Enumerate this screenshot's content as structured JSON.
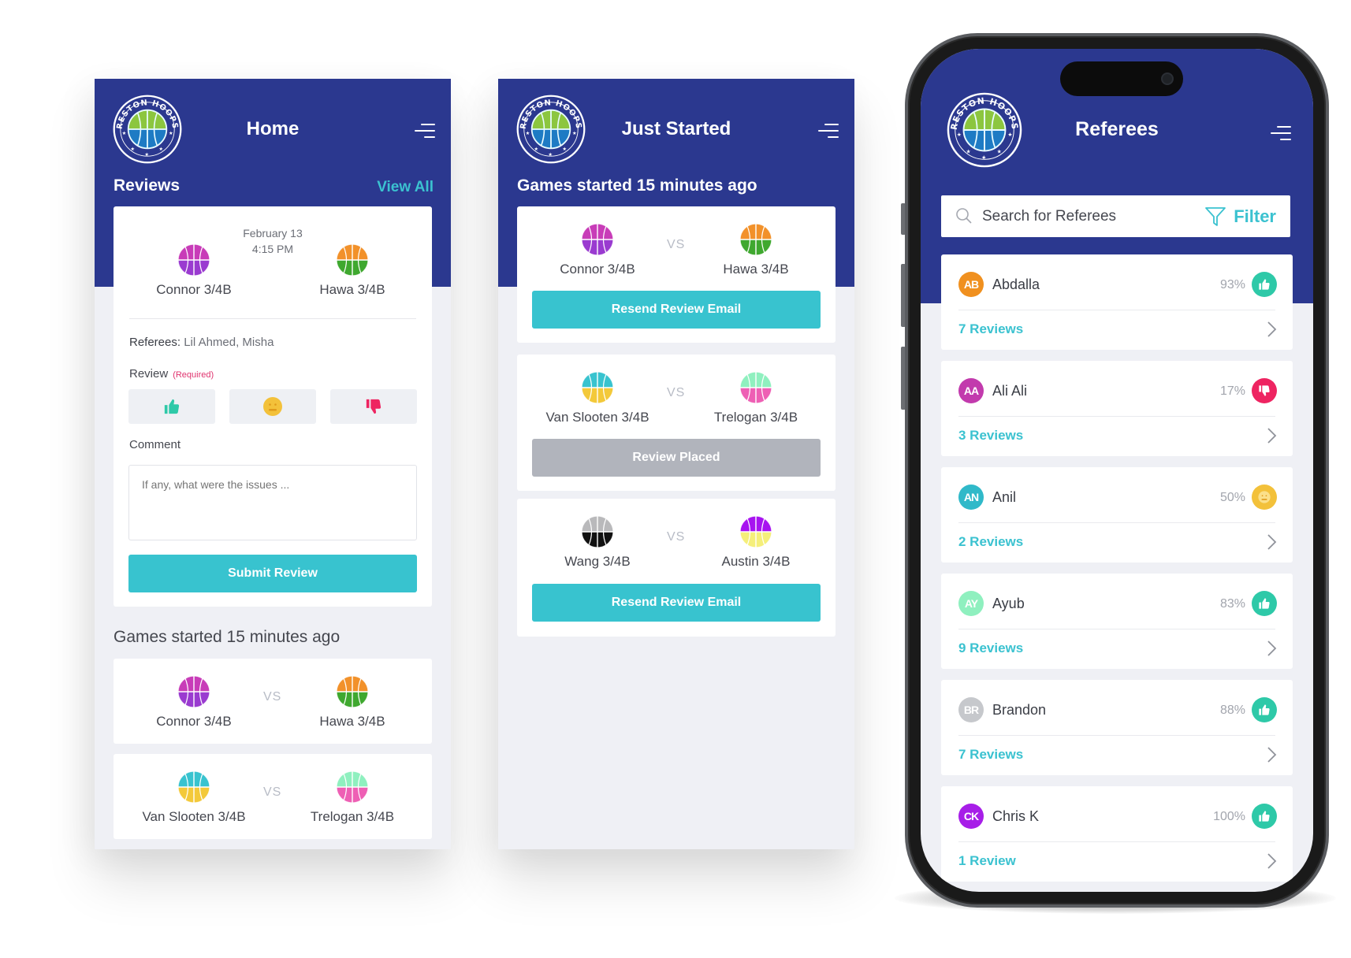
{
  "brand": {
    "logo_text": "RESTON HOOPS",
    "primary_color": "#2b388f",
    "accent_color": "#38c3cf",
    "background_color": "#eff0f5"
  },
  "home_screen": {
    "title": "Home",
    "reviews_section": {
      "title": "Reviews",
      "view_all_label": "View All"
    },
    "review_card": {
      "date": "February 13",
      "time": "4:15 PM",
      "home_team": {
        "name": "Connor 3/4B",
        "colors": [
          "#c83cb8",
          "#9a3bd0"
        ]
      },
      "away_team": {
        "name": "Hawa 3/4B",
        "colors": [
          "#f2912a",
          "#3fa82f"
        ]
      },
      "referees_label": "Referees:",
      "referees_value": "Lil Ahmed, Misha",
      "review_label": "Review",
      "required_label": "(Required)",
      "rating_options": [
        {
          "name": "thumbs-up",
          "color": "#2ec9a8"
        },
        {
          "name": "neutral-face",
          "color": "#f3c13a"
        },
        {
          "name": "thumbs-down",
          "color": "#ee2461"
        }
      ],
      "comment_label": "Comment",
      "comment_placeholder": "If any, what were the issues ...",
      "submit_label": "Submit Review"
    },
    "games_section_title": "Games started 15 minutes ago",
    "games": [
      {
        "home": {
          "name": "Connor 3/4B",
          "colors": [
            "#c83cb8",
            "#9a3bd0"
          ]
        },
        "vs": "VS",
        "away": {
          "name": "Hawa 3/4B",
          "colors": [
            "#f2912a",
            "#3fa82f"
          ]
        }
      },
      {
        "home": {
          "name": "Van Slooten 3/4B",
          "colors": [
            "#38c3cf",
            "#f3c93a"
          ]
        },
        "vs": "VS",
        "away": {
          "name": "Trelogan 3/4B",
          "colors": [
            "#8ff0bf",
            "#ee5fb4"
          ]
        }
      }
    ]
  },
  "just_started_screen": {
    "title": "Just Started",
    "section_title": "Games started 15 minutes ago",
    "games": [
      {
        "home": {
          "name": "Connor 3/4B",
          "colors": [
            "#c83cb8",
            "#9a3bd0"
          ]
        },
        "vs": "VS",
        "away": {
          "name": "Hawa 3/4B",
          "colors": [
            "#f2912a",
            "#3fa82f"
          ]
        },
        "action_label": "Resend Review Email",
        "action_state": "active"
      },
      {
        "home": {
          "name": "Van Slooten 3/4B",
          "colors": [
            "#38c3cf",
            "#f3c93a"
          ]
        },
        "vs": "VS",
        "away": {
          "name": "Trelogan 3/4B",
          "colors": [
            "#8ff0bf",
            "#ee5fb4"
          ]
        },
        "action_label": "Review Placed",
        "action_state": "disabled"
      },
      {
        "home": {
          "name": "Wang 3/4B",
          "colors": [
            "#b9b9bb",
            "#111111"
          ]
        },
        "vs": "VS",
        "away": {
          "name": "Austin 3/4B",
          "colors": [
            "#a713f0",
            "#f5ef7a"
          ]
        },
        "action_label": "Resend Review Email",
        "action_state": "active"
      }
    ]
  },
  "referees_screen": {
    "title": "Referees",
    "search_placeholder": "Search for Referees",
    "filter_label": "Filter",
    "referees": [
      {
        "initials": "AB",
        "name": "Abdalla",
        "percent": "93%",
        "rating": "thumbs-up",
        "avatar_color": "#f0901f",
        "reviews_label": "7 Reviews"
      },
      {
        "initials": "AA",
        "name": "Ali Ali",
        "percent": "17%",
        "rating": "thumbs-down",
        "avatar_color": "#c23aad",
        "reviews_label": "3 Reviews"
      },
      {
        "initials": "AN",
        "name": "Anil",
        "percent": "50%",
        "rating": "neutral",
        "avatar_color": "#30b9c9",
        "reviews_label": "2 Reviews"
      },
      {
        "initials": "AY",
        "name": "Ayub",
        "percent": "83%",
        "rating": "thumbs-up",
        "avatar_color": "#8ff0bf",
        "reviews_label": "9 Reviews"
      },
      {
        "initials": "BR",
        "name": "Brandon",
        "percent": "88%",
        "rating": "thumbs-up",
        "avatar_color": "#c6c8cc",
        "reviews_label": "7 Reviews"
      },
      {
        "initials": "CK",
        "name": "Chris K",
        "percent": "100%",
        "rating": "thumbs-up",
        "avatar_color": "#a71ee8",
        "reviews_label": "1 Review"
      }
    ],
    "rating_colors": {
      "thumbs-up": "#2ec9a8",
      "thumbs-down": "#ee2461",
      "neutral": "#f3c13a"
    }
  }
}
